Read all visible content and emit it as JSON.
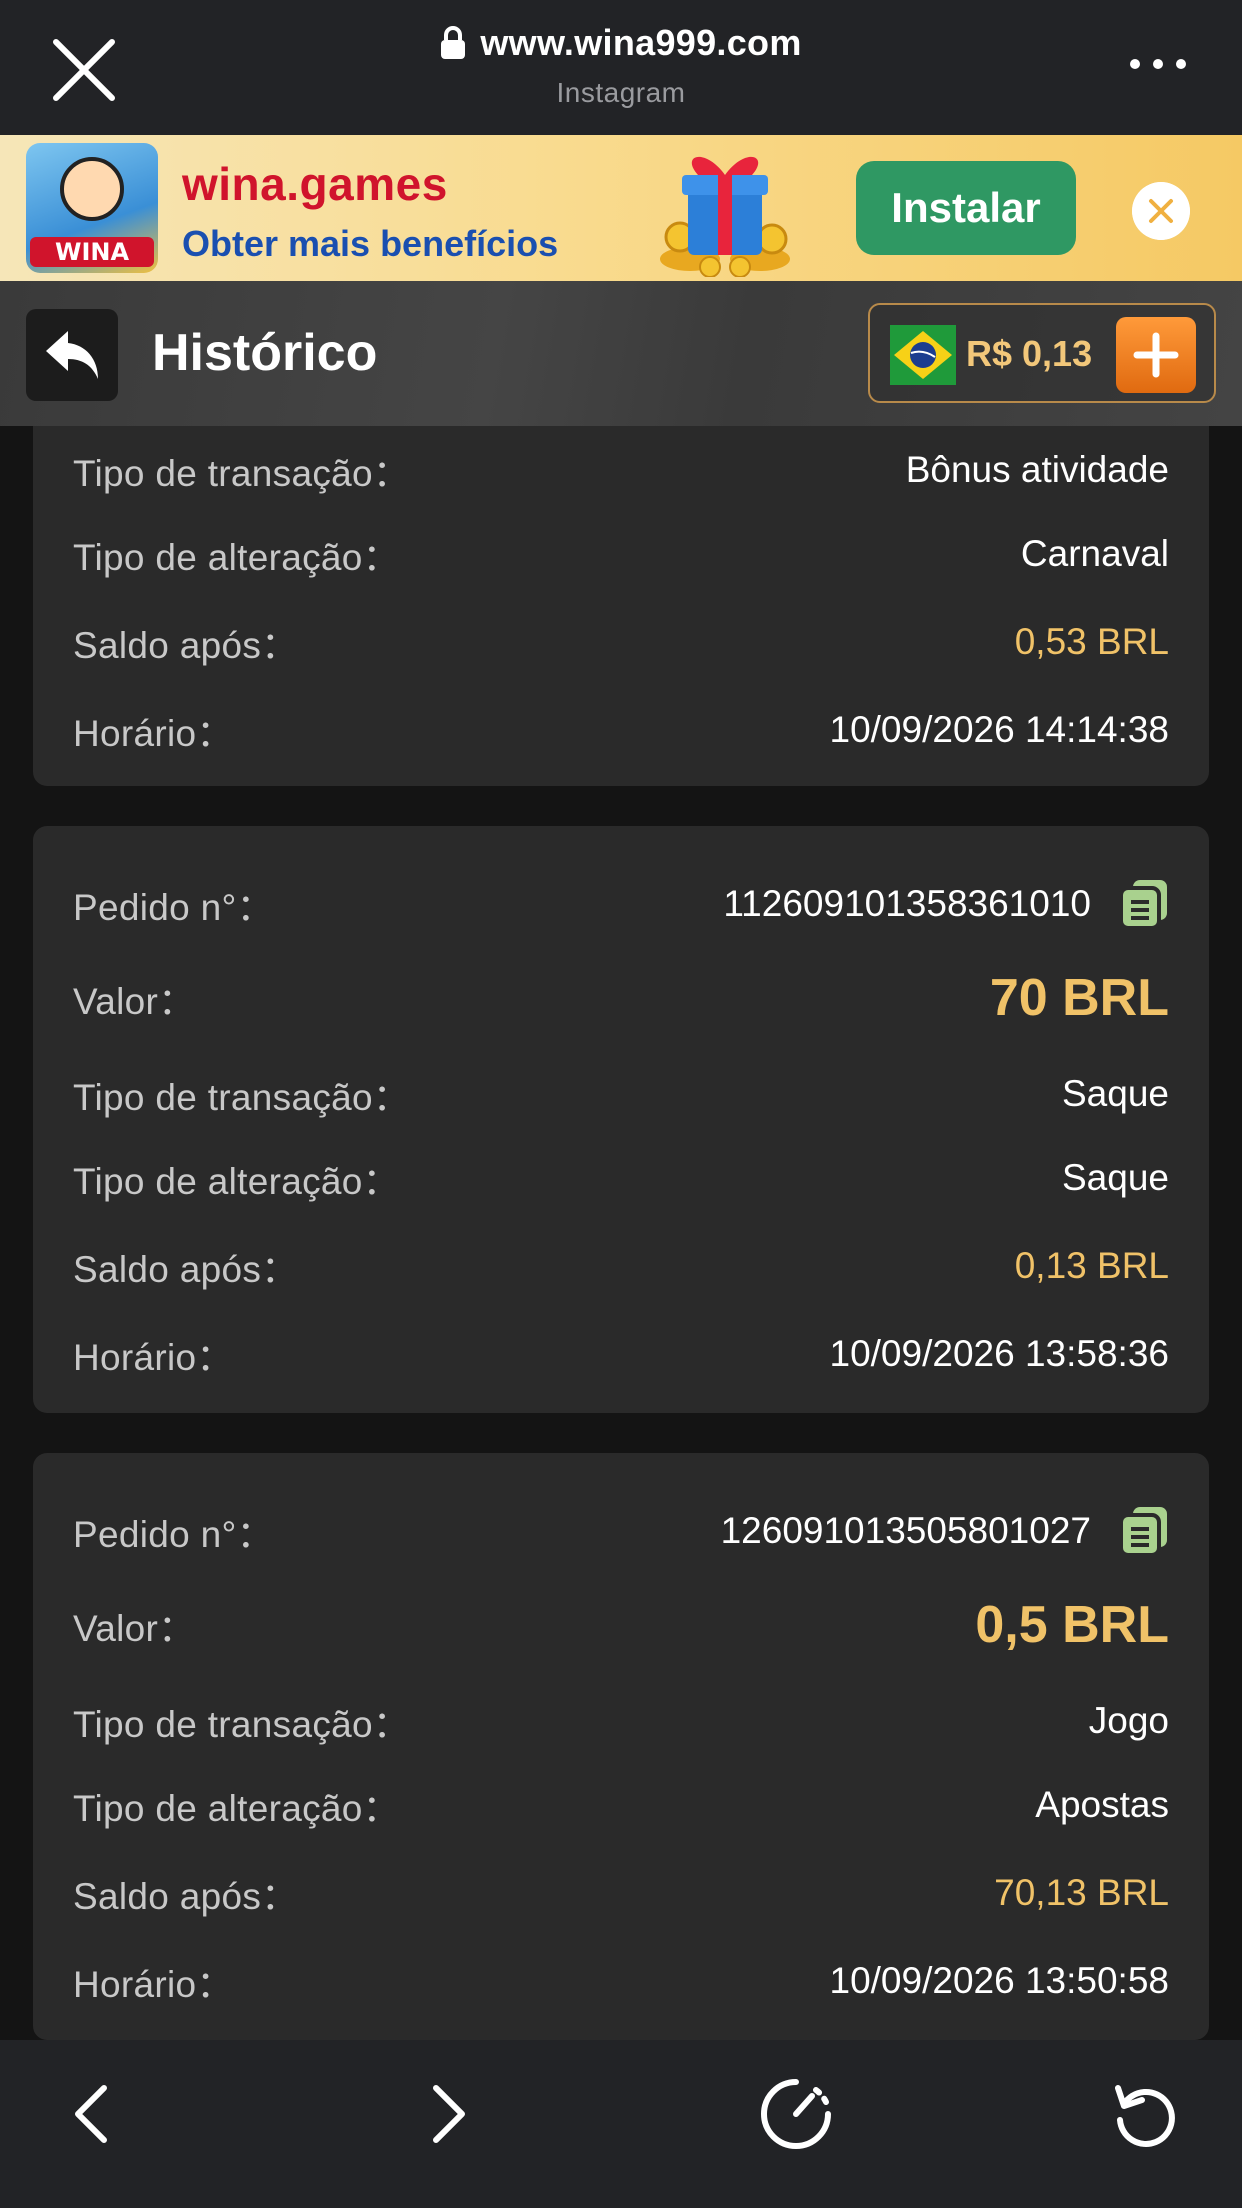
{
  "browser": {
    "url": "www.wina999.com",
    "source": "Instagram"
  },
  "banner": {
    "logo_text": "WINA",
    "title": "wina.games",
    "subtitle": "Obter mais benefícios",
    "install_label": "Instalar"
  },
  "header": {
    "title": "Histórico",
    "balance": "R$ 0,13"
  },
  "cards": [
    {
      "rows": [
        {
          "label": "Tipo de transação：",
          "value": "Bônus atividade"
        },
        {
          "label": "Tipo de alteração：",
          "value": "Carnaval"
        },
        {
          "label": "Saldo após：",
          "value": "0,53 BRL"
        },
        {
          "label": "Horário：",
          "value": "10/09/2026 14:14:38"
        }
      ]
    },
    {
      "rows": [
        {
          "label": "Pedido n°：",
          "value": "112609101358361010"
        },
        {
          "label": "Valor：",
          "value": "70 BRL"
        },
        {
          "label": "Tipo de transação：",
          "value": "Saque"
        },
        {
          "label": "Tipo de alteração：",
          "value": "Saque"
        },
        {
          "label": "Saldo após：",
          "value": "0,13 BRL"
        },
        {
          "label": "Horário：",
          "value": "10/09/2026 13:58:36"
        }
      ]
    },
    {
      "rows": [
        {
          "label": "Pedido n°：",
          "value": "126091013505801027"
        },
        {
          "label": "Valor：",
          "value": "0,5 BRL"
        },
        {
          "label": "Tipo de transação：",
          "value": "Jogo"
        },
        {
          "label": "Tipo de alteração：",
          "value": "Apostas"
        },
        {
          "label": "Saldo após：",
          "value": "70,13 BRL"
        },
        {
          "label": "Horário：",
          "value": "10/09/2026 13:50:58"
        }
      ]
    }
  ],
  "colors": {
    "accent_gold": "#f0c268",
    "install_green": "#2f9863",
    "plus_orange": "#e06a10"
  },
  "icons": [
    "close-icon",
    "lock-icon",
    "more-icon",
    "back-arrow-icon",
    "brazil-flag-icon",
    "plus-icon",
    "copy-icon",
    "chevron-left-icon",
    "chevron-right-icon",
    "speed-icon",
    "reload-icon"
  ]
}
